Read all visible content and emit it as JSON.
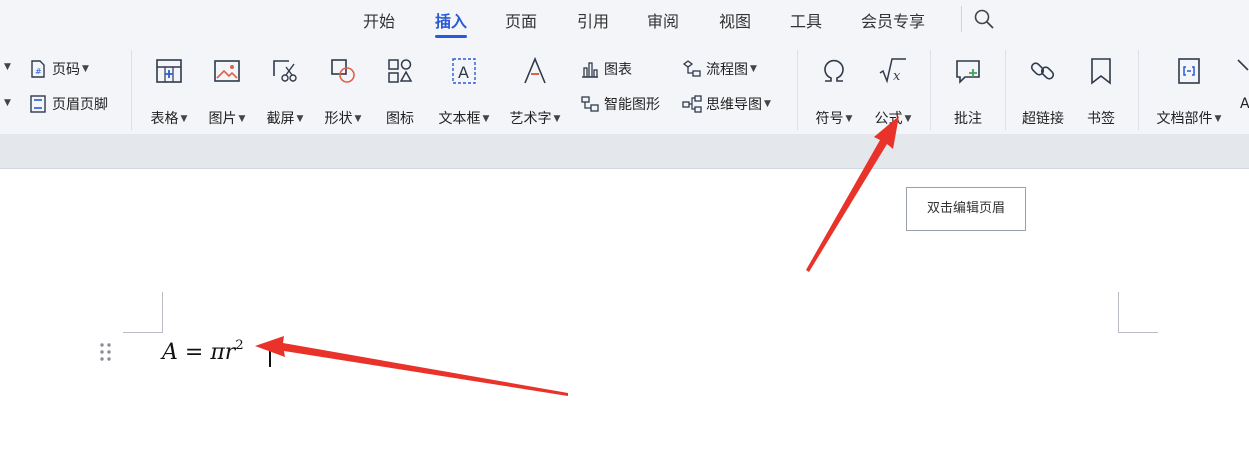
{
  "menu_tabs": [
    {
      "label": "开始",
      "active": false
    },
    {
      "label": "插入",
      "active": true
    },
    {
      "label": "页面",
      "active": false
    },
    {
      "label": "引用",
      "active": false
    },
    {
      "label": "审阅",
      "active": false
    },
    {
      "label": "视图",
      "active": false
    },
    {
      "label": "工具",
      "active": false
    },
    {
      "label": "会员专享",
      "active": false
    }
  ],
  "ribbon": {
    "page_number": "页码",
    "header_footer": "页眉页脚",
    "table": "表格",
    "picture": "图片",
    "screenshot": "截屏",
    "shape": "形状",
    "icon": "图标",
    "textbox": "文本框",
    "wordart": "艺术字",
    "chart": "图表",
    "smart_shape": "智能图形",
    "flowchart": "流程图",
    "mindmap": "思维导图",
    "symbol": "符号",
    "formula": "公式",
    "comment": "批注",
    "hyperlink": "超链接",
    "bookmark": "书签",
    "doc_parts": "文档部件"
  },
  "document": {
    "tooltip": "双击编辑页眉",
    "formula": {
      "lhs": "A",
      "equals": " = ",
      "pi": "π",
      "var": "r",
      "exp": "2"
    }
  },
  "colors": {
    "accent": "#2a5bd7",
    "annotation_arrow": "#e8322a",
    "ribbon_bg": "#f4f5f8"
  }
}
